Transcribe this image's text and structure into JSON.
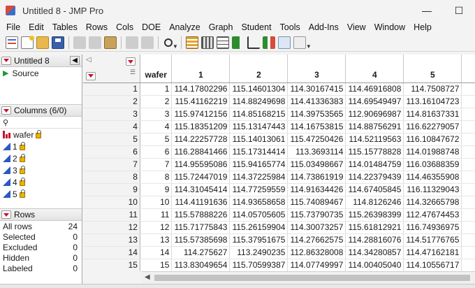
{
  "window": {
    "title": "Untitled 8 - JMP Pro",
    "min_glyph": "—",
    "max_glyph": "☐"
  },
  "menubar": [
    "File",
    "Edit",
    "Tables",
    "Rows",
    "Cols",
    "DOE",
    "Analyze",
    "Graph",
    "Student",
    "Tools",
    "Add-Ins",
    "View",
    "Window",
    "Help"
  ],
  "table_panel": {
    "title": "Untitled 8",
    "source_label": "Source"
  },
  "columns_panel": {
    "title": "Columns (6/0)",
    "search_glyph": "⚲",
    "columns": [
      "wafer",
      "1",
      "2",
      "3",
      "4",
      "5"
    ]
  },
  "rows_panel": {
    "title": "Rows",
    "stats": [
      {
        "label": "All rows",
        "value": "24"
      },
      {
        "label": "Selected",
        "value": "0"
      },
      {
        "label": "Excluded",
        "value": "0"
      },
      {
        "label": "Hidden",
        "value": "0"
      },
      {
        "label": "Labeled",
        "value": "0"
      }
    ]
  },
  "grid": {
    "headers": [
      "wafer",
      "1",
      "2",
      "3",
      "4",
      "5"
    ],
    "rows": [
      [
        "1",
        "1",
        "114.17802296",
        "115.14601304",
        "114.30167415",
        "114.46916808",
        "114.7508727"
      ],
      [
        "2",
        "2",
        "115.41162219",
        "114.88249698",
        "114.41336383",
        "114.69549497",
        "113.16104723"
      ],
      [
        "3",
        "3",
        "115.97412156",
        "114.85168215",
        "114.39753565",
        "112.90696987",
        "114.81637331"
      ],
      [
        "4",
        "4",
        "115.18351209",
        "115.13147443",
        "114.16753815",
        "114.88756291",
        "116.62279057"
      ],
      [
        "5",
        "5",
        "114.22257728",
        "115.14013061",
        "115.47250426",
        "114.52119563",
        "116.10847672"
      ],
      [
        "6",
        "6",
        "116.28841466",
        "115.17314414",
        "113.3693114",
        "115.15778828",
        "114.01988748"
      ],
      [
        "7",
        "7",
        "114.95595086",
        "115.94165774",
        "115.03498667",
        "114.01484759",
        "116.03688359"
      ],
      [
        "8",
        "8",
        "115.72447019",
        "114.37225984",
        "114.73861919",
        "114.22379439",
        "114.46355908"
      ],
      [
        "9",
        "9",
        "114.31045414",
        "114.77259559",
        "114.91634426",
        "114.67405845",
        "116.11329043"
      ],
      [
        "10",
        "10",
        "114.41191636",
        "114.93658658",
        "115.74089467",
        "114.8126246",
        "114.32665798"
      ],
      [
        "11",
        "11",
        "115.57888226",
        "114.05705605",
        "115.73790735",
        "115.26398399",
        "112.47674453"
      ],
      [
        "12",
        "12",
        "115.71775843",
        "115.26159904",
        "114.30073257",
        "115.61812921",
        "116.74936975"
      ],
      [
        "13",
        "13",
        "115.57385698",
        "115.37951675",
        "114.27662575",
        "114.28816076",
        "114.51776765"
      ],
      [
        "14",
        "14",
        "114.275627",
        "113.2490235",
        "112.86328008",
        "114.34280857",
        "114.47162181"
      ],
      [
        "15",
        "15",
        "113.83049654",
        "115.70599387",
        "114.07749997",
        "114.00405040",
        "114.10556717"
      ]
    ]
  },
  "colors": {
    "accent_red": "#c8102e",
    "continuous_blue": "#2b59c3",
    "lock_gold": "#e8b400"
  }
}
